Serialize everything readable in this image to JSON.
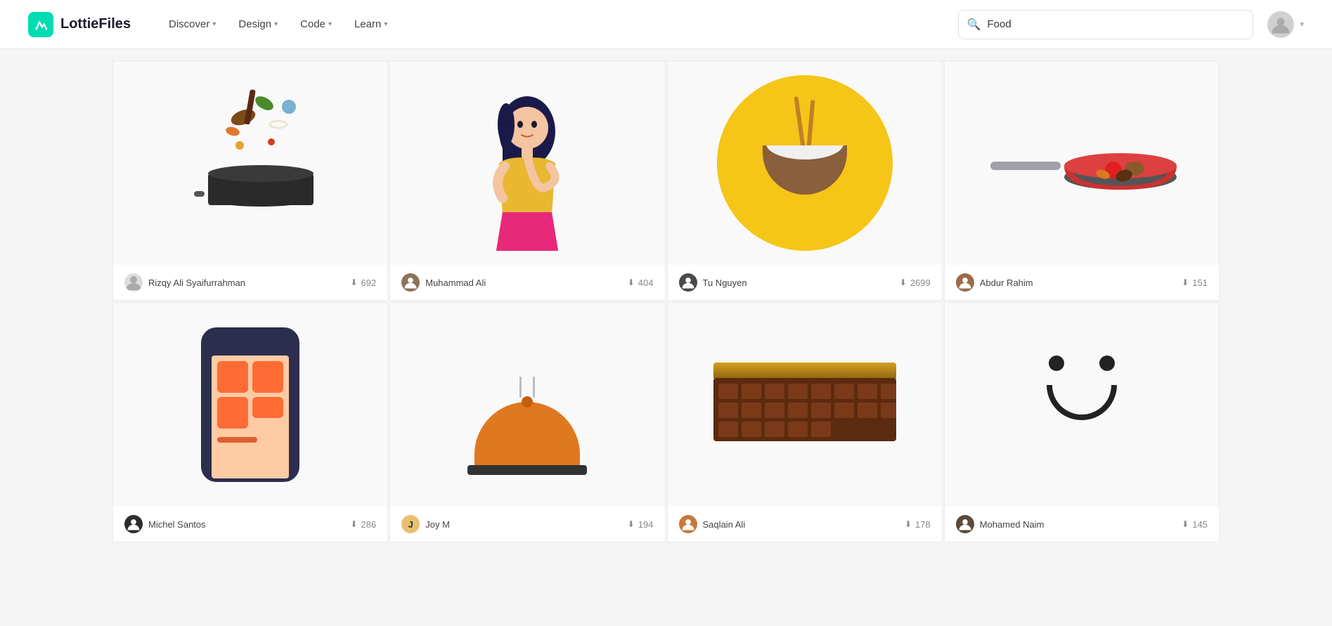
{
  "header": {
    "logo_text": "LottieFiles",
    "nav": [
      {
        "label": "Discover",
        "has_dropdown": true
      },
      {
        "label": "Design",
        "has_dropdown": true
      },
      {
        "label": "Code",
        "has_dropdown": true
      },
      {
        "label": "Learn",
        "has_dropdown": true
      }
    ],
    "search_placeholder": "Food",
    "search_value": "Food"
  },
  "grid": {
    "cards": [
      {
        "id": 1,
        "author": "Rizqy Ali Syaifurrahman",
        "downloads": "692",
        "author_bg": "#ccc"
      },
      {
        "id": 2,
        "author": "Muhammad Ali",
        "downloads": "404",
        "author_bg": "#8b7355"
      },
      {
        "id": 3,
        "author": "Tu Nguyen",
        "downloads": "2699",
        "author_bg": "#4a4a4a"
      },
      {
        "id": 4,
        "author": "Abdur Rahim",
        "downloads": "151",
        "author_bg": "#9b6b4a"
      },
      {
        "id": 5,
        "author": "Michel Santos",
        "downloads": "286",
        "author_bg": "#2d2d2d"
      },
      {
        "id": 6,
        "author": "Joy M",
        "downloads": "194",
        "author_initial": "J",
        "author_bg": "#e8c070"
      },
      {
        "id": 7,
        "author": "Saqlain Ali",
        "downloads": "178",
        "author_bg": "#c8783a"
      },
      {
        "id": 8,
        "author": "Mohamed Naim",
        "downloads": "145",
        "author_bg": "#5a4a3a"
      }
    ]
  }
}
